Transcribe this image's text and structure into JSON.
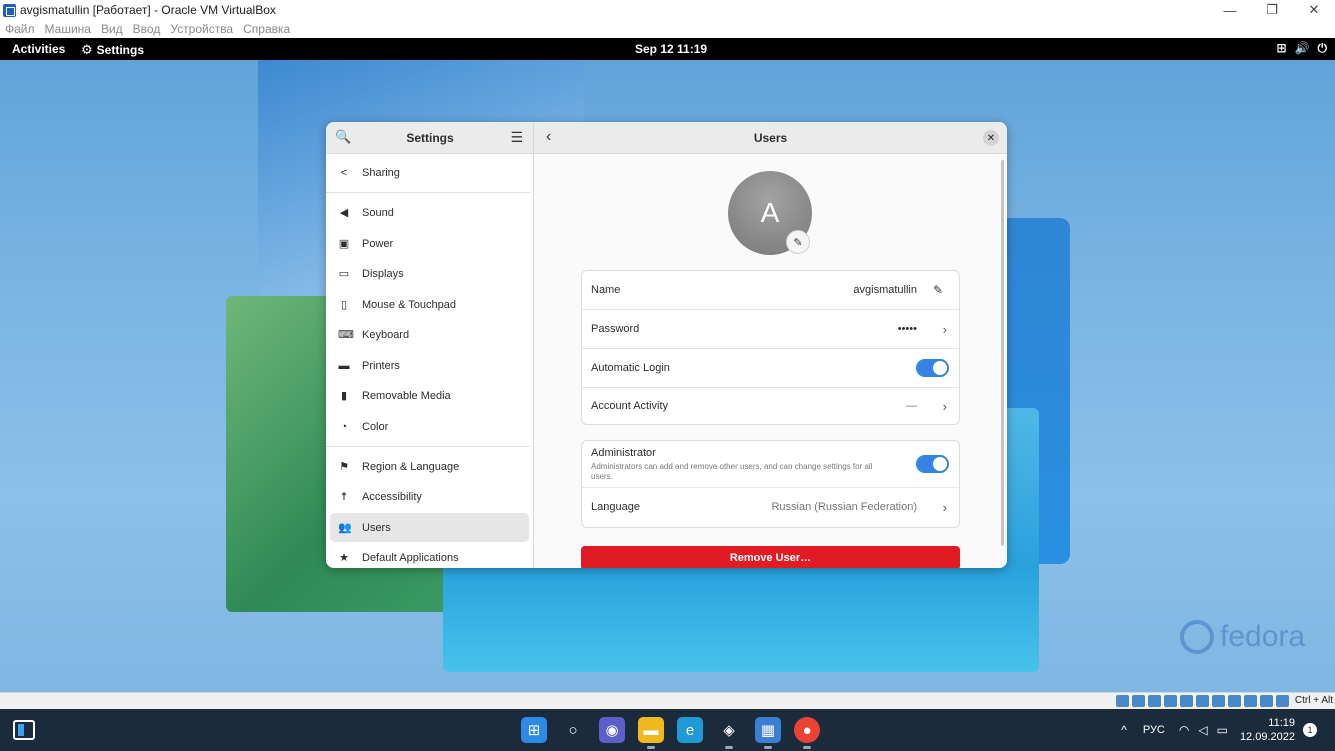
{
  "vbox": {
    "title": "avgismatullin [Работает] - Oracle VM VirtualBox",
    "menu": [
      "Файл",
      "Машина",
      "Вид",
      "Ввод",
      "Устройства",
      "Справка"
    ],
    "hostkey": "Ctrl + Alt"
  },
  "topbar": {
    "activities": "Activities",
    "app": "Settings",
    "clock": "Sep 12  11:19"
  },
  "sidebar": {
    "title": "Settings",
    "items": [
      {
        "label": "Sharing",
        "icon": "share-icon"
      },
      {
        "label": "Sound",
        "icon": "speaker-icon"
      },
      {
        "label": "Power",
        "icon": "power-icon"
      },
      {
        "label": "Displays",
        "icon": "display-icon"
      },
      {
        "label": "Mouse & Touchpad",
        "icon": "mouse-icon"
      },
      {
        "label": "Keyboard",
        "icon": "keyboard-icon"
      },
      {
        "label": "Printers",
        "icon": "printer-icon"
      },
      {
        "label": "Removable Media",
        "icon": "media-icon"
      },
      {
        "label": "Color",
        "icon": "color-icon"
      },
      {
        "label": "Region & Language",
        "icon": "flag-icon"
      },
      {
        "label": "Accessibility",
        "icon": "accessibility-icon"
      },
      {
        "label": "Users",
        "icon": "users-icon"
      },
      {
        "label": "Default Applications",
        "icon": "star-icon"
      }
    ]
  },
  "users": {
    "title": "Users",
    "avatar_letter": "A",
    "name_label": "Name",
    "name_value": "avgismatullin",
    "password_label": "Password",
    "password_value": "•••••",
    "autologin_label": "Automatic Login",
    "activity_label": "Account Activity",
    "activity_value": "—",
    "admin_label": "Administrator",
    "admin_desc": "Administrators can add and remove other users, and can change settings for all users.",
    "language_label": "Language",
    "language_value": "Russian (Russian Federation)",
    "remove_label": "Remove User…"
  },
  "taskbar": {
    "lang": "РУС",
    "time": "11:19",
    "date": "12.09.2022",
    "notifications": "1"
  },
  "brand": {
    "fedora": "fedora"
  }
}
